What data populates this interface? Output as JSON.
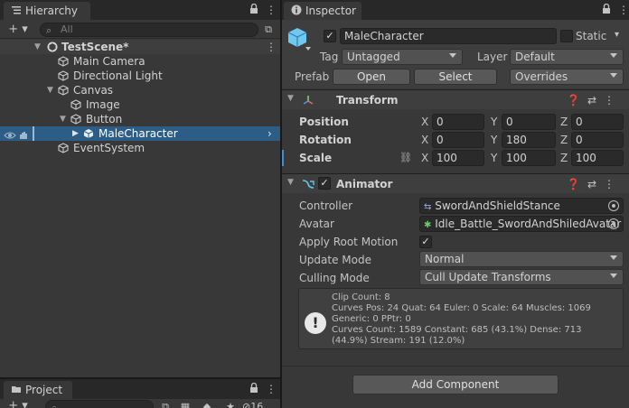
{
  "hierarchy": {
    "tab_label": "Hierarchy",
    "add_label": "+ ▾",
    "search_placeholder": "All",
    "items": [
      {
        "label": "TestScene*"
      },
      {
        "label": "Main Camera"
      },
      {
        "label": "Directional Light"
      },
      {
        "label": "Canvas"
      },
      {
        "label": "Image"
      },
      {
        "label": "Button"
      },
      {
        "label": "MaleCharacter"
      },
      {
        "label": "EventSystem"
      }
    ]
  },
  "project": {
    "tab_label": "Project",
    "add_label": "+ ▾",
    "hidden_count": "16"
  },
  "inspector": {
    "tab_label": "Inspector",
    "object_name": "MaleCharacter",
    "static_label": "Static",
    "tag_label": "Tag",
    "tag_value": "Untagged",
    "layer_label": "Layer",
    "layer_value": "Default",
    "prefab_label": "Prefab",
    "open_label": "Open",
    "select_label": "Select",
    "overrides_label": "Overrides",
    "transform": {
      "title": "Transform",
      "position_label": "Position",
      "rotation_label": "Rotation",
      "scale_label": "Scale",
      "x": "X",
      "y": "Y",
      "z": "Z",
      "position": [
        "0",
        "0",
        "0"
      ],
      "rotation": [
        "0",
        "180",
        "0"
      ],
      "scale": [
        "100",
        "100",
        "100"
      ]
    },
    "animator": {
      "title": "Animator",
      "controller_label": "Controller",
      "controller_value": "SwordAndShieldStance",
      "avatar_label": "Avatar",
      "avatar_value": "Idle_Battle_SwordAndShiledAvatar",
      "apply_root_motion_label": "Apply Root Motion",
      "update_mode_label": "Update Mode",
      "update_mode_value": "Normal",
      "culling_mode_label": "Culling Mode",
      "culling_mode_value": "Cull Update Transforms",
      "info_lines": [
        "Clip Count: 8",
        "Curves Pos: 24 Quat: 64 Euler: 0 Scale: 64 Muscles: 1069 Generic: 0 PPtr: 0",
        "Curves Count: 1589 Constant: 685 (43.1%) Dense: 713 (44.9%) Stream: 191 (12.0%)"
      ]
    },
    "add_component_label": "Add Component"
  },
  "colors": {
    "selection": "#2c5d87",
    "panel_bg": "#383838",
    "tab_bar": "#282828"
  }
}
